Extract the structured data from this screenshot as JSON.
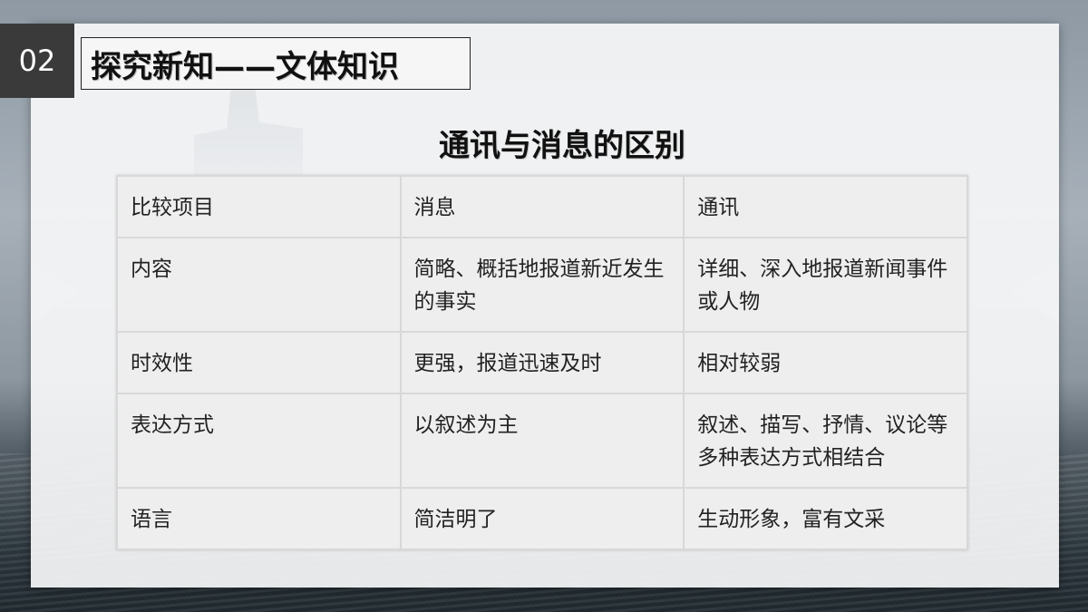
{
  "badge": {
    "number": "02"
  },
  "section_title": "探究新知——文体知识",
  "table_title": "通讯与消息的区别",
  "table": {
    "headers": [
      "比较项目",
      "消息",
      "通讯"
    ],
    "rows": [
      {
        "item": "内容",
        "xiaoxi": "简略、概括地报道新近发生的事实",
        "tongxun": "详细、深入地报道新闻事件或人物"
      },
      {
        "item": "时效性",
        "xiaoxi": "更强，报道迅速及时",
        "tongxun": "相对较弱"
      },
      {
        "item": "表达方式",
        "xiaoxi": "以叙述为主",
        "tongxun": "叙述、描写、抒情、议论等多种表达方式相结合"
      },
      {
        "item": "语言",
        "xiaoxi": "简洁明了",
        "tongxun": "生动形象，富有文采"
      }
    ]
  }
}
